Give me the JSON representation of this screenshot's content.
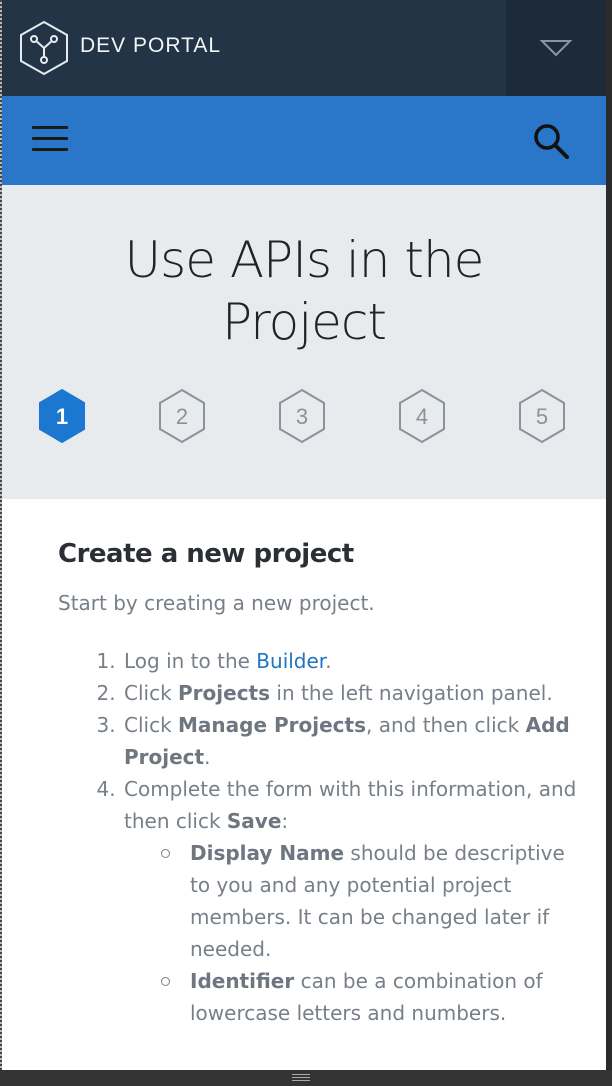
{
  "header": {
    "brand": "DEV PORTAL",
    "logo_icon": "hex-network-icon",
    "menu_toggle_icon": "triangle-down-icon"
  },
  "navbar": {
    "menu_icon": "hamburger-icon",
    "search_icon": "search-icon",
    "color": "#2a76c8"
  },
  "hero": {
    "title_line1": "Use APIs in the",
    "title_line2": "Project",
    "steps": [
      {
        "label": "1",
        "active": true
      },
      {
        "label": "2",
        "active": false
      },
      {
        "label": "3",
        "active": false
      },
      {
        "label": "4",
        "active": false
      },
      {
        "label": "5",
        "active": false
      }
    ],
    "active_color": "#1b77d0"
  },
  "content": {
    "heading": "Create a new project",
    "intro": "Start by creating a new project.",
    "item1_pre": "Log in to the ",
    "item1_link": "Builder",
    "item1_post": ".",
    "item2_pre": "Click ",
    "item2_bold": "Projects",
    "item2_post": " in the left navigation panel.",
    "item3_pre": "Click ",
    "item3_bold1": "Manage Projects",
    "item3_mid": ", and then click ",
    "item3_bold2": "Add Project",
    "item3_post": ".",
    "item4_pre": "Complete the form with this information, and then click ",
    "item4_bold": "Save",
    "item4_post": ":",
    "sub1_bold": "Display Name",
    "sub1_text": " should be descriptive to you and any potential project members. It can be changed later if needed.",
    "sub2_bold": "Identifier",
    "sub2_text": " can be a combination of lowercase letters and numbers."
  }
}
